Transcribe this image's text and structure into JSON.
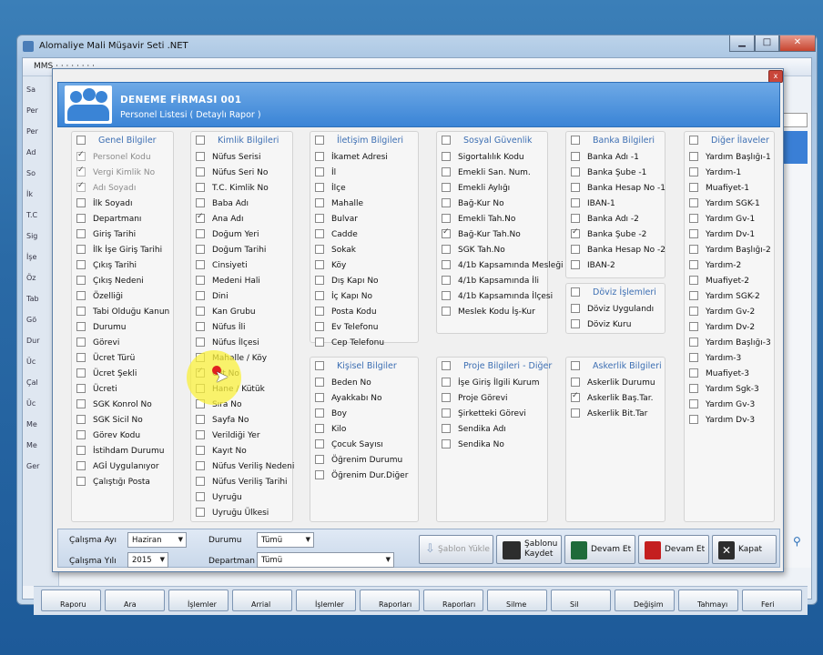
{
  "main_window": {
    "title": "Alomaliye Mali Müşavir Seti .NET",
    "menu": "MMS ·  ·  ·  ·  ·  ·  ·  · ",
    "left_labels": [
      "Sa",
      "Per",
      "Per",
      "Ad",
      "So",
      "İk",
      "T.C",
      "Sig",
      "İşe",
      "Öz",
      "Tab",
      "Gö",
      "Dur",
      "Üc",
      "Çal",
      "Üc",
      "Me",
      "Me",
      "Ger"
    ],
    "bottom_buttons": [
      "Raporu",
      "Ara",
      "İşlemler",
      "Arrial",
      "İşlemler",
      "Raporları",
      "Raporları",
      "Silme",
      "Sil",
      "Değişim",
      "Tahmayı",
      "Feri"
    ]
  },
  "dialog": {
    "firm_name": "DENEME FİRMASI 001",
    "subtitle": "Personel Listesi ( Detaylı Rapor )",
    "close": "x",
    "groups": [
      {
        "title": "Genel Bilgiler",
        "checked": false,
        "items": [
          {
            "label": "Personel Kodu",
            "checked": true,
            "disabled": true
          },
          {
            "label": "Vergi Kimlik No",
            "checked": true,
            "disabled": true
          },
          {
            "label": "Adı Soyadı",
            "checked": true,
            "disabled": true
          },
          {
            "label": "İlk Soyadı",
            "checked": false
          },
          {
            "label": "Departmanı",
            "checked": false
          },
          {
            "label": "Giriş Tarihi",
            "checked": false
          },
          {
            "label": "İlk İşe Giriş Tarihi",
            "checked": false
          },
          {
            "label": "Çıkış Tarihi",
            "checked": false
          },
          {
            "label": "Çıkış Nedeni",
            "checked": false
          },
          {
            "label": "Özelliği",
            "checked": false
          },
          {
            "label": "Tabi Olduğu Kanun",
            "checked": false
          },
          {
            "label": "Durumu",
            "checked": false
          },
          {
            "label": "Görevi",
            "checked": false
          },
          {
            "label": "Ücret Türü",
            "checked": false
          },
          {
            "label": "Ücret Şekli",
            "checked": false
          },
          {
            "label": "Ücreti",
            "checked": false
          },
          {
            "label": "SGK Konrol No",
            "checked": false
          },
          {
            "label": "SGK Sicil No",
            "checked": false
          },
          {
            "label": "Görev Kodu",
            "checked": false
          },
          {
            "label": "İstihdam Durumu",
            "checked": false
          },
          {
            "label": "AGİ Uygulanıyor",
            "checked": false
          },
          {
            "label": "Çalıştığı Posta",
            "checked": false
          }
        ]
      },
      {
        "title": "Kimlik Bilgileri",
        "checked": false,
        "items": [
          {
            "label": "Nüfus Serisi",
            "checked": false
          },
          {
            "label": "Nüfus Seri No",
            "checked": false
          },
          {
            "label": "T.C. Kimlik No",
            "checked": false
          },
          {
            "label": "Baba Adı",
            "checked": false
          },
          {
            "label": "Ana Adı",
            "checked": true
          },
          {
            "label": "Doğum Yeri",
            "checked": false
          },
          {
            "label": "Doğum Tarihi",
            "checked": false
          },
          {
            "label": "Cinsiyeti",
            "checked": false
          },
          {
            "label": "Medeni Hali",
            "checked": false
          },
          {
            "label": "Dini",
            "checked": false
          },
          {
            "label": "Kan Grubu",
            "checked": false
          },
          {
            "label": "Nüfus İli",
            "checked": false
          },
          {
            "label": "Nüfus İlçesi",
            "checked": false
          },
          {
            "label": "Mahalle / Köy",
            "checked": false
          },
          {
            "label": "Cilt No",
            "checked": true
          },
          {
            "label": "Hane / Kütük",
            "checked": false
          },
          {
            "label": "Sıra No",
            "checked": false
          },
          {
            "label": "Sayfa No",
            "checked": false
          },
          {
            "label": "Verildiği Yer",
            "checked": false
          },
          {
            "label": "Kayıt No",
            "checked": false
          },
          {
            "label": "Nüfus Veriliş Nedeni",
            "checked": false
          },
          {
            "label": "Nüfus Veriliş Tarihi",
            "checked": false
          },
          {
            "label": "Uyruğu",
            "checked": false
          },
          {
            "label": "Uyruğu Ülkesi",
            "checked": false
          }
        ]
      },
      {
        "title": "İletişim Bilgileri",
        "checked": false,
        "items": [
          {
            "label": "İkamet Adresi",
            "checked": false
          },
          {
            "label": "İl",
            "checked": false
          },
          {
            "label": "İlçe",
            "checked": false
          },
          {
            "label": "Mahalle",
            "checked": false
          },
          {
            "label": "Bulvar",
            "checked": false
          },
          {
            "label": "Cadde",
            "checked": false
          },
          {
            "label": "Sokak",
            "checked": false
          },
          {
            "label": "Köy",
            "checked": false
          },
          {
            "label": "Dış Kapı No",
            "checked": false
          },
          {
            "label": "İç Kapı No",
            "checked": false
          },
          {
            "label": "Posta Kodu",
            "checked": false
          },
          {
            "label": "Ev Telefonu",
            "checked": false
          },
          {
            "label": "Cep Telefonu",
            "checked": false
          }
        ]
      },
      {
        "title": "Sosyal Güvenlik",
        "checked": false,
        "items": [
          {
            "label": "Sigortalılık Kodu",
            "checked": false
          },
          {
            "label": "Emekli San. Num.",
            "checked": false
          },
          {
            "label": "Emekli Aylığı",
            "checked": false
          },
          {
            "label": "Bağ-Kur No",
            "checked": false
          },
          {
            "label": "Emekli Tah.No",
            "checked": false
          },
          {
            "label": "Bağ-Kur Tah.No",
            "checked": true
          },
          {
            "label": "SGK Tah.No",
            "checked": false
          },
          {
            "label": "4/1b Kapsamında Mesleği",
            "checked": false
          },
          {
            "label": "4/1b Kapsamında İli",
            "checked": false
          },
          {
            "label": "4/1b Kapsamında İlçesi",
            "checked": false
          },
          {
            "label": "Meslek Kodu İş-Kur",
            "checked": false
          }
        ]
      },
      {
        "title": "Banka Bilgileri",
        "checked": false,
        "items": [
          {
            "label": "Banka Adı -1",
            "checked": false
          },
          {
            "label": "Banka Şube -1",
            "checked": false
          },
          {
            "label": "Banka Hesap No -1",
            "checked": false
          },
          {
            "label": "IBAN-1",
            "checked": false
          },
          {
            "label": "Banka Adı -2",
            "checked": false
          },
          {
            "label": "Banka Şube -2",
            "checked": true
          },
          {
            "label": "Banka Hesap No -2",
            "checked": false
          },
          {
            "label": "IBAN-2",
            "checked": false
          }
        ]
      },
      {
        "title": "Diğer İlaveler",
        "checked": false,
        "items": [
          {
            "label": "Yardım Başlığı-1",
            "checked": false
          },
          {
            "label": "Yardım-1",
            "checked": false
          },
          {
            "label": "Muafiyet-1",
            "checked": false
          },
          {
            "label": "Yardım SGK-1",
            "checked": false
          },
          {
            "label": "Yardım Gv-1",
            "checked": false
          },
          {
            "label": "Yardım Dv-1",
            "checked": false
          },
          {
            "label": "Yardım Başlığı-2",
            "checked": false
          },
          {
            "label": "Yardım-2",
            "checked": false
          },
          {
            "label": "Muafiyet-2",
            "checked": false
          },
          {
            "label": "Yardım SGK-2",
            "checked": false
          },
          {
            "label": "Yardım Gv-2",
            "checked": false
          },
          {
            "label": "Yardım Dv-2",
            "checked": false
          },
          {
            "label": "Yardım Başlığı-3",
            "checked": false
          },
          {
            "label": "Yardım-3",
            "checked": false
          },
          {
            "label": "Muafiyet-3",
            "checked": false
          },
          {
            "label": "Yardım Sgk-3",
            "checked": false
          },
          {
            "label": "Yardım Gv-3",
            "checked": false
          },
          {
            "label": "Yardım Dv-3",
            "checked": false
          }
        ]
      },
      {
        "title": "Döviz İşlemleri",
        "checked": false,
        "items": [
          {
            "label": "Döviz Uygulandı",
            "checked": false
          },
          {
            "label": "Döviz Kuru",
            "checked": false
          }
        ]
      },
      {
        "title": "Kişisel Bilgiler",
        "checked": false,
        "items": [
          {
            "label": "Beden No",
            "checked": false
          },
          {
            "label": "Ayakkabı No",
            "checked": false
          },
          {
            "label": "Boy",
            "checked": false
          },
          {
            "label": "Kilo",
            "checked": false
          },
          {
            "label": "Çocuk Sayısı",
            "checked": false
          },
          {
            "label": "Öğrenim Durumu",
            "checked": false
          },
          {
            "label": "Öğrenim Dur.Diğer",
            "checked": false
          }
        ]
      },
      {
        "title": "Proje Bilgileri - Diğer",
        "checked": false,
        "items": [
          {
            "label": "İşe Giriş İlgili Kurum",
            "checked": false
          },
          {
            "label": "Proje Görevi",
            "checked": false
          },
          {
            "label": "Şirketteki Görevi",
            "checked": false
          },
          {
            "label": "Sendika Adı",
            "checked": false
          },
          {
            "label": "Sendika No",
            "checked": false
          }
        ]
      },
      {
        "title": "Askerlik Bilgileri",
        "checked": false,
        "items": [
          {
            "label": "Askerlik Durumu",
            "checked": false
          },
          {
            "label": "Askerlik Baş.Tar.",
            "checked": true
          },
          {
            "label": "Askerlik Bit.Tar",
            "checked": false
          }
        ]
      }
    ],
    "filters": {
      "month_label": "Çalışma Ayı",
      "month_value": "Haziran",
      "year_label": "Çalışma Yılı",
      "year_value": "2015",
      "status_label": "Durumu",
      "status_value": "Tümü",
      "dept_label": "Departman",
      "dept_value": "Tümü"
    },
    "actions": {
      "load_template": "Şablon Yükle",
      "save_template_1": "Şablonu",
      "save_template_2": "Kaydet",
      "continue_excel": "Devam Et",
      "continue_report": "Devam Et",
      "close": "Kapat"
    }
  },
  "colors": {
    "header_blue": "#3a84d6",
    "title_blue": "#3d6fb3",
    "highlight": "#faf03c"
  }
}
